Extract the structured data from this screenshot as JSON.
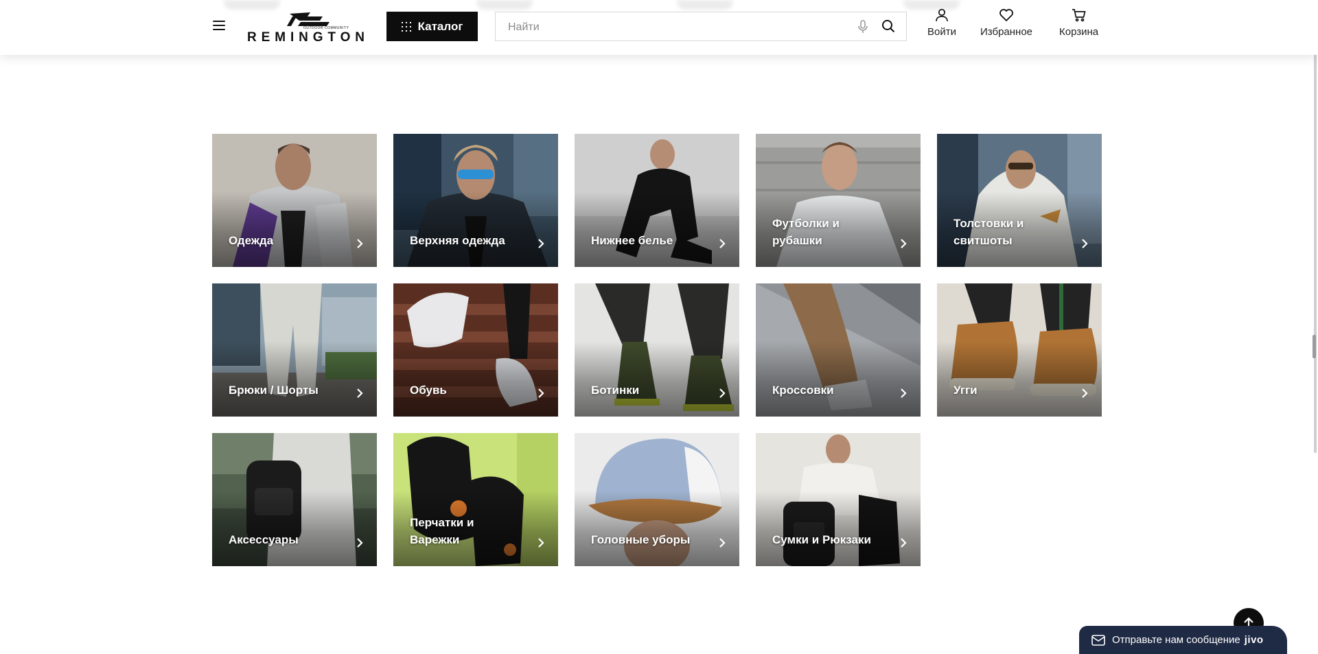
{
  "header": {
    "logo_text": "REMINGTON",
    "logo_tagline": "OUTDOOR COMMUNITY",
    "catalog_label": "Каталог",
    "search_placeholder": "Найти",
    "login_label": "Войти",
    "favorites_label": "Избранное",
    "cart_label": "Корзина"
  },
  "categories": [
    {
      "label": "Одежда",
      "icon": "jacket-photo"
    },
    {
      "label": "Верхняя одежда",
      "icon": "outerwear-photo"
    },
    {
      "label": "Нижнее белье",
      "icon": "underwear-photo"
    },
    {
      "label": "Футболки и рубашки",
      "icon": "shirt-photo"
    },
    {
      "label": "Толстовки и свитшоты",
      "icon": "hoodie-photo"
    },
    {
      "label": "Брюки / Шорты",
      "icon": "pants-photo"
    },
    {
      "label": "Обувь",
      "icon": "footwear-photo"
    },
    {
      "label": "Ботинки",
      "icon": "boots-photo"
    },
    {
      "label": "Кроссовки",
      "icon": "sneakers-photo"
    },
    {
      "label": "Угги",
      "icon": "uggs-photo"
    },
    {
      "label": "Аксессуары",
      "icon": "accessories-photo"
    },
    {
      "label": "Перчатки и Варежки",
      "icon": "gloves-photo"
    },
    {
      "label": "Головные уборы",
      "icon": "cap-photo"
    },
    {
      "label": "Сумки и Рюкзаки",
      "icon": "backpack-photo"
    }
  ],
  "chat": {
    "label": "Отправьте нам сообщение",
    "brand": "jivo"
  },
  "colors": {
    "accent": "#0d0d0d",
    "chat_bg": "#1f2a44",
    "tile_text": "#ffffff"
  }
}
